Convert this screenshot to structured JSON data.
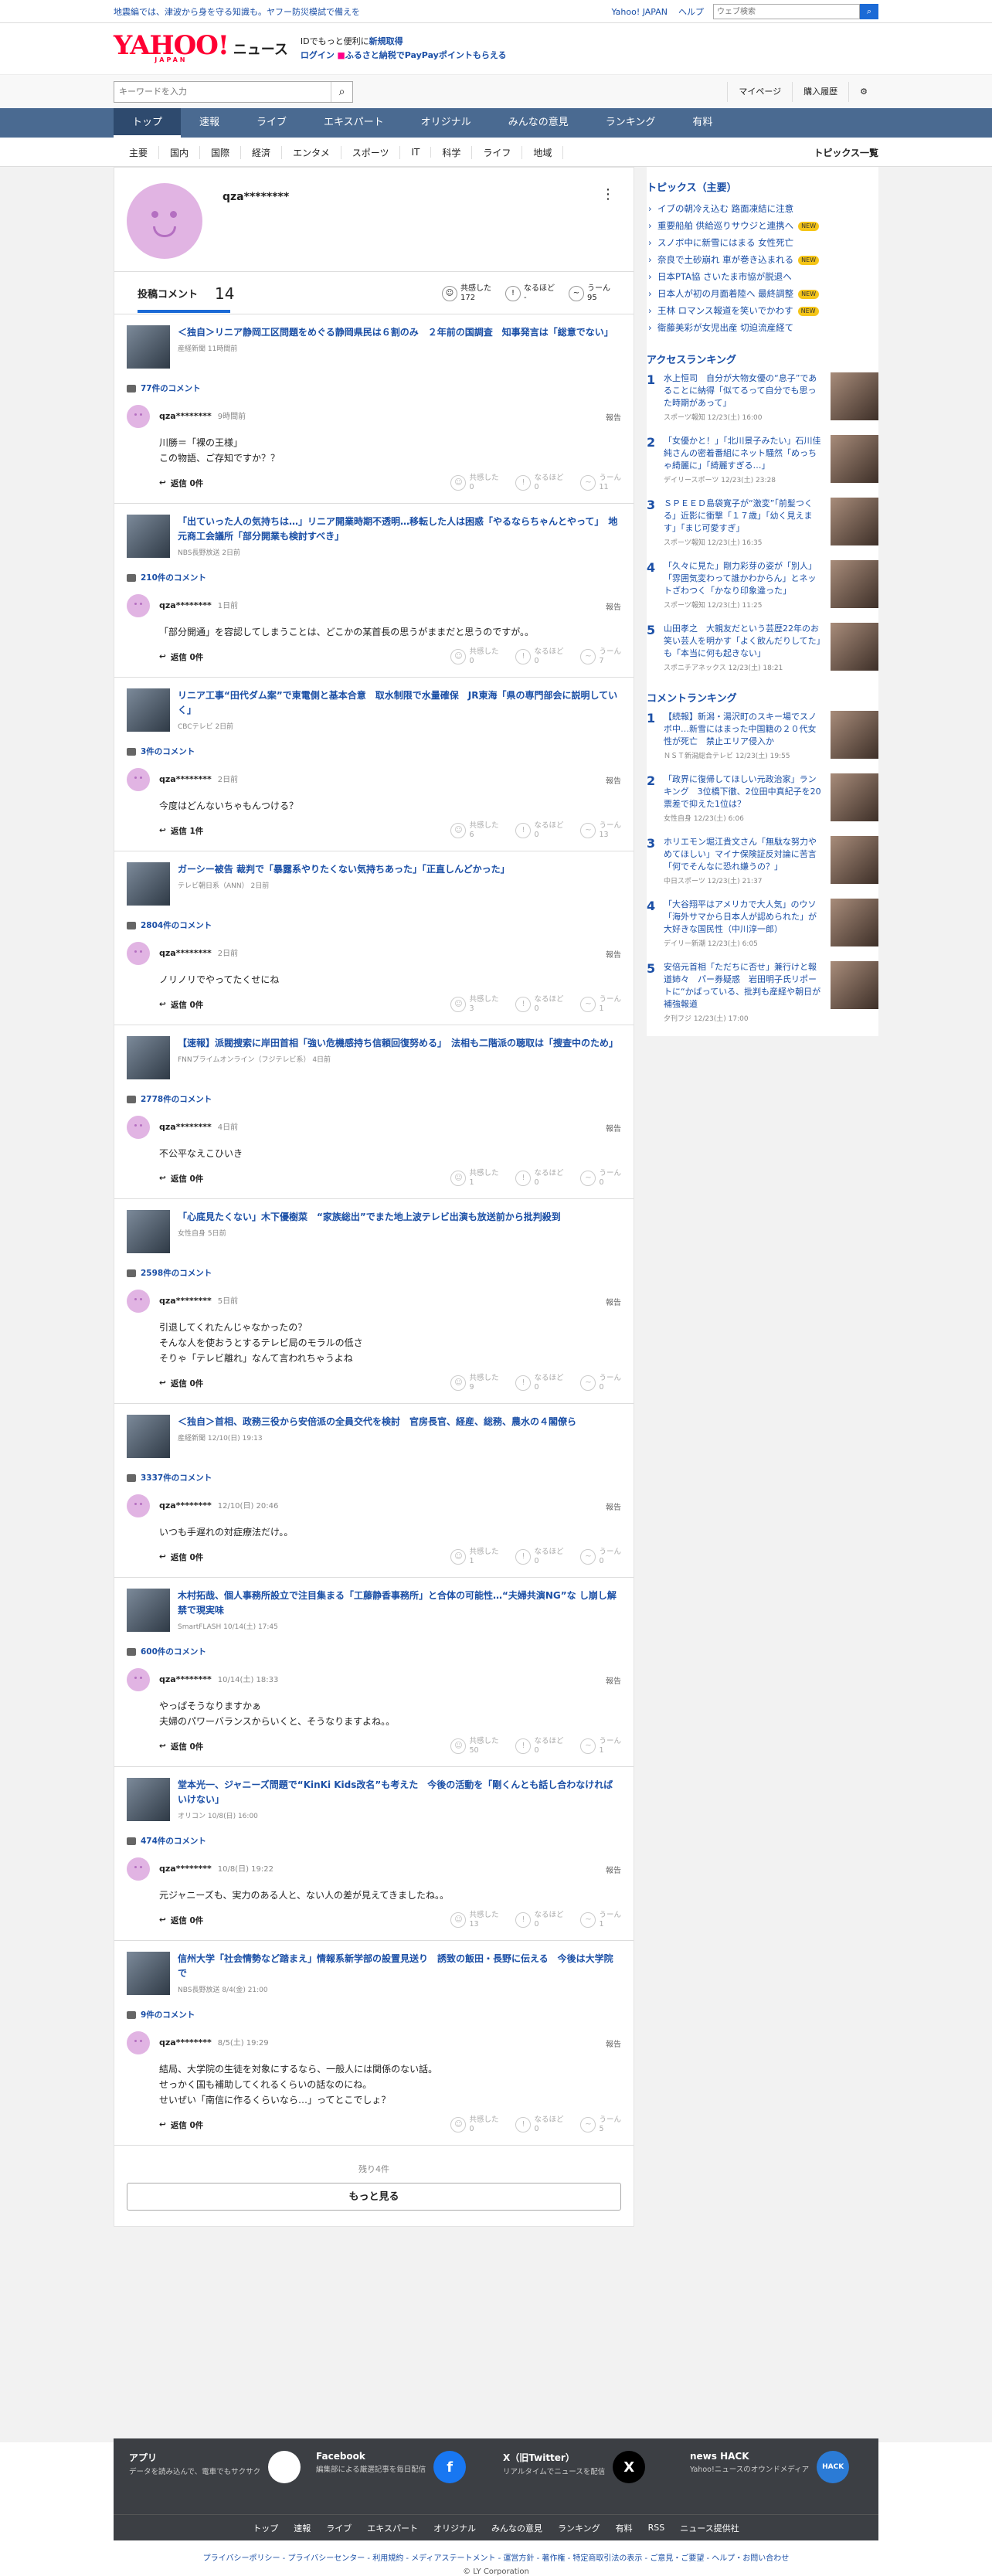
{
  "topbar": {
    "notice": "地震編では、津波から身を守る知識も。ヤフー防災模試で備えを",
    "links": [
      "Yahoo! JAPAN",
      "ヘルプ"
    ],
    "search_placeholder": "ウェブ検索"
  },
  "header": {
    "logo_text": "YAHOO!",
    "logo_sub": "JAPAN",
    "section_title": "ニュース",
    "id_msg_prefix": "IDでもっと便利に",
    "signup": "新規取得",
    "login": "ログイン",
    "login_msg": "ふるさと納税でPayPayポイントもらえる"
  },
  "subbar": {
    "keyword_placeholder": "キーワードを入力",
    "mypage": "マイページ",
    "purchase": "購入履歴"
  },
  "global_nav": [
    "トップ",
    "速報",
    "ライブ",
    "エキスパート",
    "オリジナル",
    "みんなの意見",
    "ランキング",
    "有料"
  ],
  "category_nav": [
    "主要",
    "国内",
    "国際",
    "経済",
    "エンタメ",
    "スポーツ",
    "IT",
    "科学",
    "ライフ",
    "地域"
  ],
  "category_all": "トピックス一覧",
  "profile": {
    "name": "qza********",
    "posts_label": "投稿コメント",
    "posts_count": "14",
    "reactions": [
      {
        "label": "共感した",
        "value": "172"
      },
      {
        "label": "なるほど",
        "value": "-"
      },
      {
        "label": "うーん",
        "value": "95"
      }
    ]
  },
  "reaction_labels": [
    "共感した",
    "なるほど",
    "うーん"
  ],
  "reply_label": "返信 0件",
  "report_label": "報告",
  "entries": [
    {
      "title": "＜独自＞リニア静岡工区問題をめぐる静岡県民は６割のみ　２年前の国調査　知事発言は「総意でない」",
      "source": "産経新聞 11時間前",
      "comment_count": "77件のコメント",
      "user": "qza********",
      "date": "9時間前",
      "body": "川勝＝「裸の王様」\nこの物語、ご存知ですか？？",
      "reply": "返信 0件",
      "r": [
        "0",
        "0",
        "11"
      ]
    },
    {
      "title": "「出ていった人の気持ちは…」リニア開業時期不透明…移転した人は困惑「やるならちゃんとやって」　地元商工会議所「部分開業も検討すべき」",
      "source": "NBS長野放送 2日前",
      "comment_count": "210件のコメント",
      "user": "qza********",
      "date": "1日前",
      "body": "「部分開通」を容認してしまうことは、どこかの某首長の思うがままだと思うのですが。。",
      "reply": "返信 0件",
      "r": [
        "0",
        "0",
        "7"
      ]
    },
    {
      "title": "リニア工事“田代ダム案”で東電側と基本合意　取水制限で水量確保　JR東海「県の専門部会に説明していく」",
      "source": "CBCテレビ 2日前",
      "comment_count": "3件のコメント",
      "user": "qza********",
      "date": "2日前",
      "body": "今度はどんないちゃもんつける？",
      "reply": "返信 1件",
      "r": [
        "6",
        "0",
        "13"
      ]
    },
    {
      "title": "ガーシー被告 裁判で「暴露系やりたくない気持ちあった」「正直しんどかった」",
      "source": "テレビ朝日系（ANN） 2日前",
      "comment_count": "2804件のコメント",
      "user": "qza********",
      "date": "2日前",
      "body": "ノリノリでやってたくせにね",
      "reply": "返信 0件",
      "r": [
        "3",
        "0",
        "1"
      ]
    },
    {
      "title": "【速報】派閥捜索に岸田首相「強い危機感持ち信頼回復努める」　法相も二階派の聴取は「捜査中のため」",
      "source": "FNNプライムオンライン（フジテレビ系） 4日前",
      "comment_count": "2778件のコメント",
      "user": "qza********",
      "date": "4日前",
      "body": "不公平なえこひいき",
      "reply": "返信 0件",
      "r": [
        "1",
        "0",
        "0"
      ]
    },
    {
      "title": "「心底見たくない」木下優樹菜　“家族総出”でまた地上波テレビ出演も放送前から批判殺到",
      "source": "女性自身 5日前",
      "comment_count": "2598件のコメント",
      "user": "qza********",
      "date": "5日前",
      "body": "引退してくれたんじゃなかったの？\nそんな人を使おうとするテレビ局のモラルの低さ\nそりゃ「テレビ離れ」なんて言われちゃうよね",
      "reply": "返信 0件",
      "r": [
        "9",
        "0",
        "0"
      ]
    },
    {
      "title": "＜独自＞首相、政務三役から安倍派の全員交代を検討　官房長官、経産、総務、農水の４閣僚ら",
      "source": "産経新聞 12/10(日) 19:13",
      "comment_count": "3337件のコメント",
      "user": "qza********",
      "date": "12/10(日) 20:46",
      "body": "いつも手遅れの対症療法だけ。。",
      "reply": "返信 0件",
      "r": [
        "1",
        "0",
        "0"
      ]
    },
    {
      "title": "木村拓哉、個人事務所設立で注目集まる「工藤静香事務所」と合体の可能性…“夫婦共演NG”な し崩し解禁で現実味",
      "source": "SmartFLASH 10/14(土) 17:45",
      "comment_count": "600件のコメント",
      "user": "qza********",
      "date": "10/14(土) 18:33",
      "body": "やっぱそうなりますかぁ\n夫婦のパワーバランスからいくと、そうなりますよね。。",
      "reply": "返信 0件",
      "r": [
        "50",
        "0",
        "1"
      ]
    },
    {
      "title": "堂本光一、ジャニーズ問題で“KinKi Kids改名”も考えた　今後の活動を「剛くんとも話し合わなければいけない」",
      "source": "オリコン 10/8(日) 16:00",
      "comment_count": "474件のコメント",
      "user": "qza********",
      "date": "10/8(日) 19:22",
      "body": "元ジャニーズも、実力のある人と、ない人の差が見えてきましたね。。",
      "reply": "返信 0件",
      "r": [
        "13",
        "0",
        "1"
      ]
    },
    {
      "title": "信州大学「社会情勢など踏まえ」情報系新学部の設置見送り　誘致の飯田・長野に伝える　今後は大学院で",
      "source": "NBS長野放送 8/4(金) 21:00",
      "comment_count": "9件のコメント",
      "user": "qza********",
      "date": "8/5(土) 19:29",
      "body": "結局、大学院の生徒を対象にするなら、一般人には関係のない話。\nせっかく国も補助してくれるくらいの話なのにね。\nせいぜい「南信に作るくらいなら…」ってとこでしょ？",
      "reply": "返信 0件",
      "r": [
        "0",
        "0",
        "5"
      ]
    }
  ],
  "remaining": "残り4件",
  "more_button": "もっと見る",
  "side": {
    "topics_title": "トピックス（主要）",
    "topics": [
      {
        "t": "イブの朝冷え込む 路面凍結に注意",
        "tag": ""
      },
      {
        "t": "重要船舶 供給巡りサウジと連携へ",
        "tag": "NEW"
      },
      {
        "t": "スノボ中に新雪にはまる 女性死亡",
        "tag": ""
      },
      {
        "t": "奈良で土砂崩れ 車が巻き込まれる",
        "tag": "NEW"
      },
      {
        "t": "日本PTA協 さいたま市協が脱退へ",
        "tag": ""
      },
      {
        "t": "日本人が初の月面着陸へ 最終調整",
        "tag": "NEW"
      },
      {
        "t": "王林 ロマンス報道を笑いでかわす",
        "tag": "NEW"
      },
      {
        "t": "衛藤美彩が女児出産 切迫流産経て",
        "tag": ""
      }
    ],
    "access_title": "アクセスランキング",
    "access": [
      {
        "t": "水上恒司　自分が大物女優の“息子”であることに納得「似てるって自分でも思った時期があって」",
        "s": "スポーツ報知 12/23(土) 16:00"
      },
      {
        "t": "「女優かと！」「北川景子みたい」石川佳純さんの密着番組にネット騒然「めっちゃ綺麗に」「綺麗すぎる…」",
        "s": "デイリースポーツ 12/23(土) 23:28"
      },
      {
        "t": "ＳＰＥＥＤ島袋寛子が“激変”「前髪つくる」近影に衝撃「１７歳」「幼く見えます」「まじ可愛すぎ」",
        "s": "スポーツ報知 12/23(土) 16:35"
      },
      {
        "t": "「久々に見た」剛力彩芽の姿が「別人」「雰囲気変わって誰かわからん」とネットざわつく「かなり印象違った」",
        "s": "スポーツ報知 12/23(土) 11:25"
      },
      {
        "t": "山田孝之　大親友だという芸歴22年のお笑い芸人を明かす「よく飲んだりしてた」も「本当に何も起きない」",
        "s": "スポニチアネックス 12/23(土) 18:21"
      }
    ],
    "comment_title": "コメントランキング",
    "comment_rank": [
      {
        "t": "【続報】新潟・湯沢町のスキー場でスノボ中…新雪にはまった中国籍の２０代女性が死亡　禁止エリア侵入か",
        "s": "ＮＳＴ新潟総合テレビ 12/23(土) 19:55"
      },
      {
        "t": "「政界に復帰してほしい元政治家」ランキング　3位橋下徹、2位田中真紀子を20票差で抑えた1位は？",
        "s": "女性自身 12/23(土) 6:06"
      },
      {
        "t": "ホリエモン堀江貴文さん「無駄な努力やめてほしい」マイナ保険証反対論に苦言「何でそんなに恐れ嫌うの？」",
        "s": "中日スポーツ 12/23(土) 21:37"
      },
      {
        "t": "「大谷翔平はアメリカで大人気」のウソ　「海外サマから日本人が認められた」が大好きな国民性（中川淳一郎）",
        "s": "デイリー新潮 12/23(土) 6:05"
      },
      {
        "t": "安倍元首相「ただちに否せ」兼行けと報道姉々　パー券疑惑　岩田明子氏リポートに“かばっている、批判も産経や朝日が補強報道",
        "s": "夕刊フジ 12/23(土) 17:00"
      }
    ]
  },
  "footer": {
    "apps": [
      {
        "h": "アプリ",
        "d": "データを読み込んで、電車でもサクサク",
        "icon": "Y!"
      },
      {
        "h": "Facebook",
        "d": "編集部による厳選記事を毎日配信",
        "icon": "f"
      },
      {
        "h": "X（旧Twitter）",
        "d": "リアルタイムでニュースを配信",
        "icon": "X"
      },
      {
        "h": "news HACK",
        "d": "Yahoo!ニュースのオウンドメディア",
        "icon": "HACK"
      }
    ],
    "nav": [
      "トップ",
      "速報",
      "ライブ",
      "エキスパート",
      "オリジナル",
      "みんなの意見",
      "ランキング",
      "有料",
      "RSS",
      "ニュース提供社"
    ],
    "links": "プライバシーポリシー - プライバシーセンター - 利用規約 - メディアステートメント - 運営方針 - 著作権 - 特定商取引法の表示 - ご意見・ご要望 - ヘルプ・お問い合わせ",
    "copyright": "© LY Corporation"
  }
}
